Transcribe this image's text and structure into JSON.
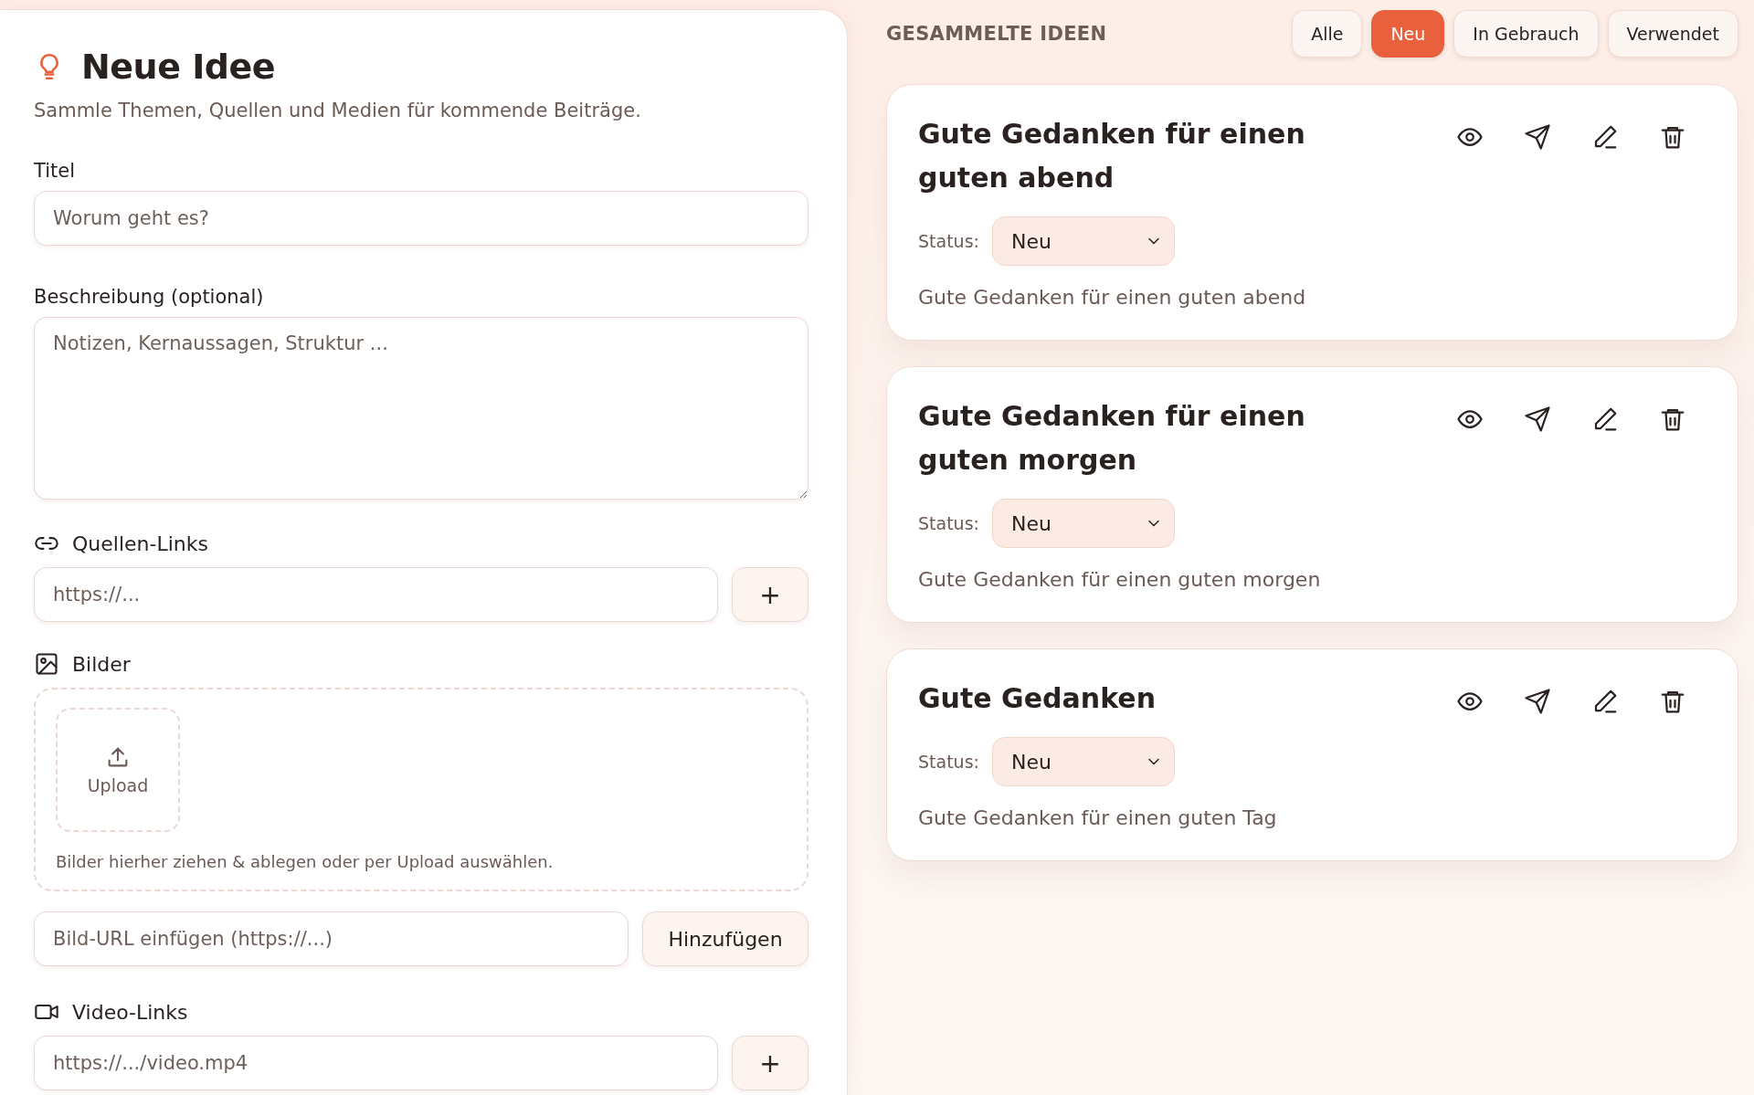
{
  "form": {
    "title": "Neue Idee",
    "subtitle": "Sammle Themen, Quellen und Medien für kommende Beiträge.",
    "title_field": {
      "label": "Titel",
      "placeholder": "Worum geht es?"
    },
    "description_field": {
      "label": "Beschreibung (optional)",
      "placeholder": "Notizen, Kernaussagen, Struktur ..."
    },
    "source_links": {
      "label": "Quellen-Links",
      "placeholder": "https://...",
      "button": "+"
    },
    "images": {
      "label": "Bilder",
      "upload": "Upload",
      "hint": "Bilder hierher ziehen & ablegen oder per Upload auswählen.",
      "url_placeholder": "Bild-URL einfügen (https://...)",
      "add_button": "Hinzufügen"
    },
    "video_links": {
      "label": "Video-Links",
      "placeholder": "https://.../video.mp4",
      "button": "+"
    }
  },
  "ideas": {
    "heading": "GESAMMELTE IDEEN",
    "filters": [
      {
        "label": "Alle",
        "selected": false
      },
      {
        "label": "Neu",
        "selected": true
      },
      {
        "label": "In Gebrauch",
        "selected": false
      },
      {
        "label": "Verwendet",
        "selected": false
      }
    ],
    "cards": [
      {
        "title": "Gute Gedanken für einen guten abend",
        "status_label": "Status:",
        "status": "Neu",
        "description": "Gute Gedanken für einen guten abend"
      },
      {
        "title": "Gute Gedanken für einen guten morgen",
        "status_label": "Status:",
        "status": "Neu",
        "description": "Gute Gedanken für einen guten morgen"
      },
      {
        "title": "Gute Gedanken",
        "status_label": "Status:",
        "status": "Neu",
        "description": "Gute Gedanken für einen guten Tag"
      }
    ]
  }
}
